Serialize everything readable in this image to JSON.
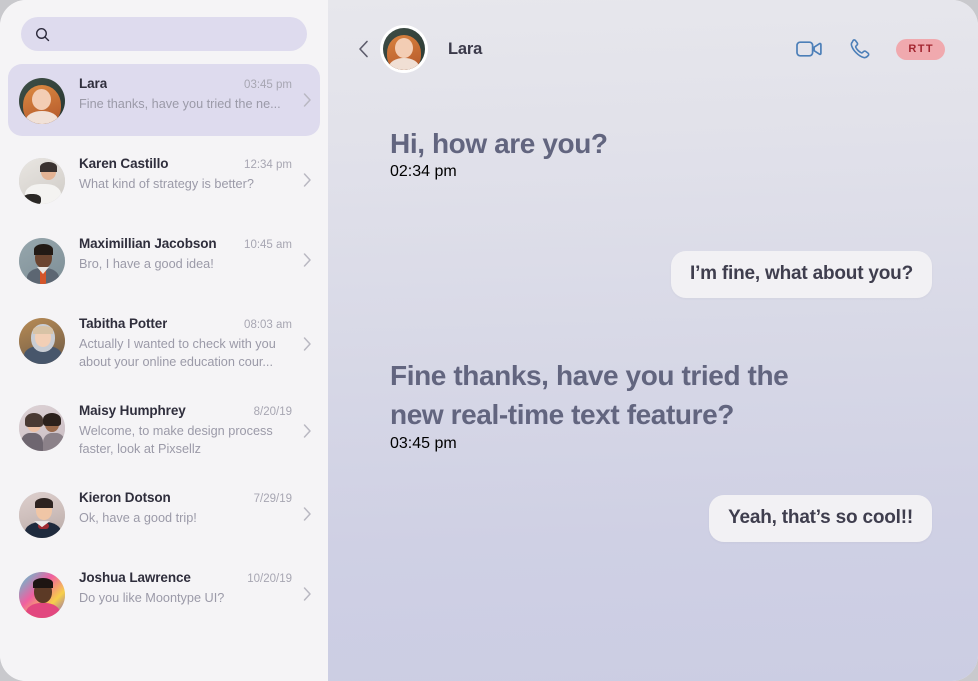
{
  "search": {
    "placeholder": "",
    "value": "",
    "icon": "search-icon"
  },
  "sidebar": {
    "conversations": [
      {
        "name": "Lara",
        "time": "03:45 pm",
        "preview": "Fine thanks, have you tried the ne...",
        "selected": true,
        "avatar": "avatar-lara"
      },
      {
        "name": "Karen Castillo",
        "time": "12:34 pm",
        "preview": "What kind of strategy is better?",
        "selected": false,
        "avatar": "avatar-karen"
      },
      {
        "name": "Maximillian Jacobson",
        "time": "10:45 am",
        "preview": "Bro, I have a good idea!",
        "selected": false,
        "avatar": "avatar-maximillian"
      },
      {
        "name": "Tabitha Potter",
        "time": "08:03 am",
        "preview": "Actually I wanted to check with you about your online education cour...",
        "selected": false,
        "avatar": "avatar-tabitha"
      },
      {
        "name": "Maisy Humphrey",
        "time": "8/20/19",
        "preview": "Welcome, to make design process faster, look at Pixsellz",
        "selected": false,
        "avatar": "avatar-maisy"
      },
      {
        "name": "Kieron Dotson",
        "time": "7/29/19",
        "preview": "Ok, have a good trip!",
        "selected": false,
        "avatar": "avatar-kieron"
      },
      {
        "name": "Joshua Lawrence",
        "time": "10/20/19",
        "preview": "Do you like Moontype UI?",
        "selected": false,
        "avatar": "avatar-joshua"
      }
    ]
  },
  "chat": {
    "header": {
      "back_label": "Back",
      "contact_name": "Lara",
      "video_call_icon": "video-camera-icon",
      "voice_call_icon": "phone-icon",
      "rtt_label": "RTT"
    },
    "messages": [
      {
        "direction": "incoming",
        "text": "Hi, how are you?",
        "time": "02:34 pm"
      },
      {
        "direction": "outgoing",
        "text": "I’m fine, what about you?",
        "time": ""
      },
      {
        "direction": "incoming",
        "text": "Fine thanks, have you tried the new real-time text feature?",
        "time": "03:45 pm"
      },
      {
        "direction": "outgoing",
        "text": "Yeah, that’s so cool!!",
        "time": ""
      }
    ]
  },
  "colors": {
    "sidebar_bg": "#f5f4f6",
    "selected_item_bg": "#dedbee",
    "search_bg": "#dedbee",
    "chat_bg_top": "#e7e7ec",
    "chat_bg_bottom": "#cbcde3",
    "incoming_text": "#62657f",
    "outgoing_bubble_bg": "#f2f1f4",
    "rtt_badge_bg": "#f0a9ae",
    "rtt_badge_text": "#a32630",
    "call_icon": "#4c7fb8"
  }
}
